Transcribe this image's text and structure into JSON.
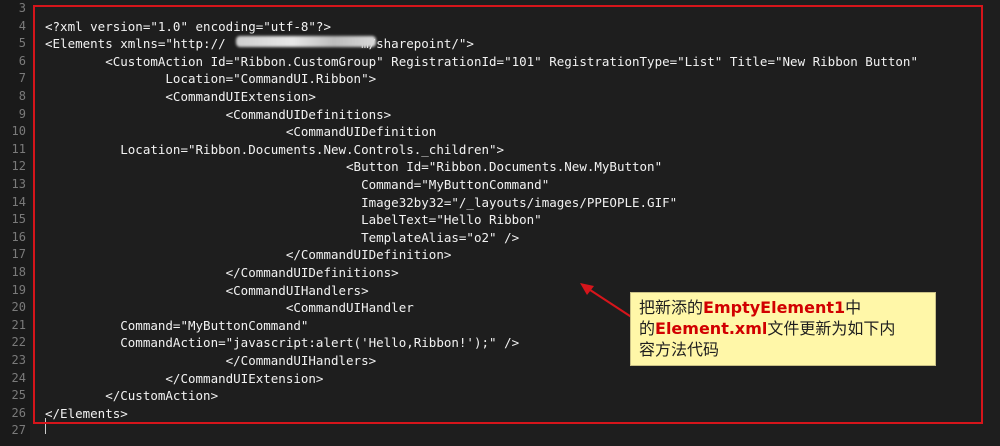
{
  "editor": {
    "lines": [
      {
        "num": "3",
        "text": ""
      },
      {
        "num": "4",
        "text": "<?xml version=\"1.0\" encoding=\"utf-8\"?>"
      },
      {
        "num": "5",
        "text": "<Elements xmlns=\"http://                  m/sharepoint/\">"
      },
      {
        "num": "6",
        "text": "        <CustomAction Id=\"Ribbon.CustomGroup\" RegistrationId=\"101\" RegistrationType=\"List\" Title=\"New Ribbon Button\""
      },
      {
        "num": "7",
        "text": "                Location=\"CommandUI.Ribbon\">"
      },
      {
        "num": "8",
        "text": "                <CommandUIExtension>"
      },
      {
        "num": "9",
        "text": "                        <CommandUIDefinitions>"
      },
      {
        "num": "10",
        "text": "                                <CommandUIDefinition"
      },
      {
        "num": "11",
        "text": "          Location=\"Ribbon.Documents.New.Controls._children\">"
      },
      {
        "num": "12",
        "text": "                                        <Button Id=\"Ribbon.Documents.New.MyButton\""
      },
      {
        "num": "13",
        "text": "                                          Command=\"MyButtonCommand\""
      },
      {
        "num": "14",
        "text": "                                          Image32by32=\"/_layouts/images/PPEOPLE.GIF\""
      },
      {
        "num": "15",
        "text": "                                          LabelText=\"Hello Ribbon\""
      },
      {
        "num": "16",
        "text": "                                          TemplateAlias=\"o2\" />"
      },
      {
        "num": "17",
        "text": "                                </CommandUIDefinition>"
      },
      {
        "num": "18",
        "text": "                        </CommandUIDefinitions>"
      },
      {
        "num": "19",
        "text": "                        <CommandUIHandlers>"
      },
      {
        "num": "20",
        "text": "                                <CommandUIHandler"
      },
      {
        "num": "21",
        "text": "          Command=\"MyButtonCommand\""
      },
      {
        "num": "22",
        "text": "          CommandAction=\"javascript:alert('Hello,Ribbon!');\" />"
      },
      {
        "num": "23",
        "text": "                        </CommandUIHandlers>"
      },
      {
        "num": "24",
        "text": "                </CommandUIExtension>"
      },
      {
        "num": "25",
        "text": "        </CustomAction>"
      },
      {
        "num": "26",
        "text": "</Elements>"
      },
      {
        "num": "27",
        "text": ""
      }
    ]
  },
  "annotation": {
    "part1": "把新添的",
    "part2": "EmptyElement1",
    "part3": "中",
    "part4": "的",
    "part5": "Element.xml",
    "part6": "文件更新为如下内",
    "part7": "容方法代码"
  },
  "colors": {
    "background": "#1e1e1e",
    "highlight_border": "#d6151b",
    "note_background": "#fff7a8",
    "note_accent": "#d10000"
  }
}
